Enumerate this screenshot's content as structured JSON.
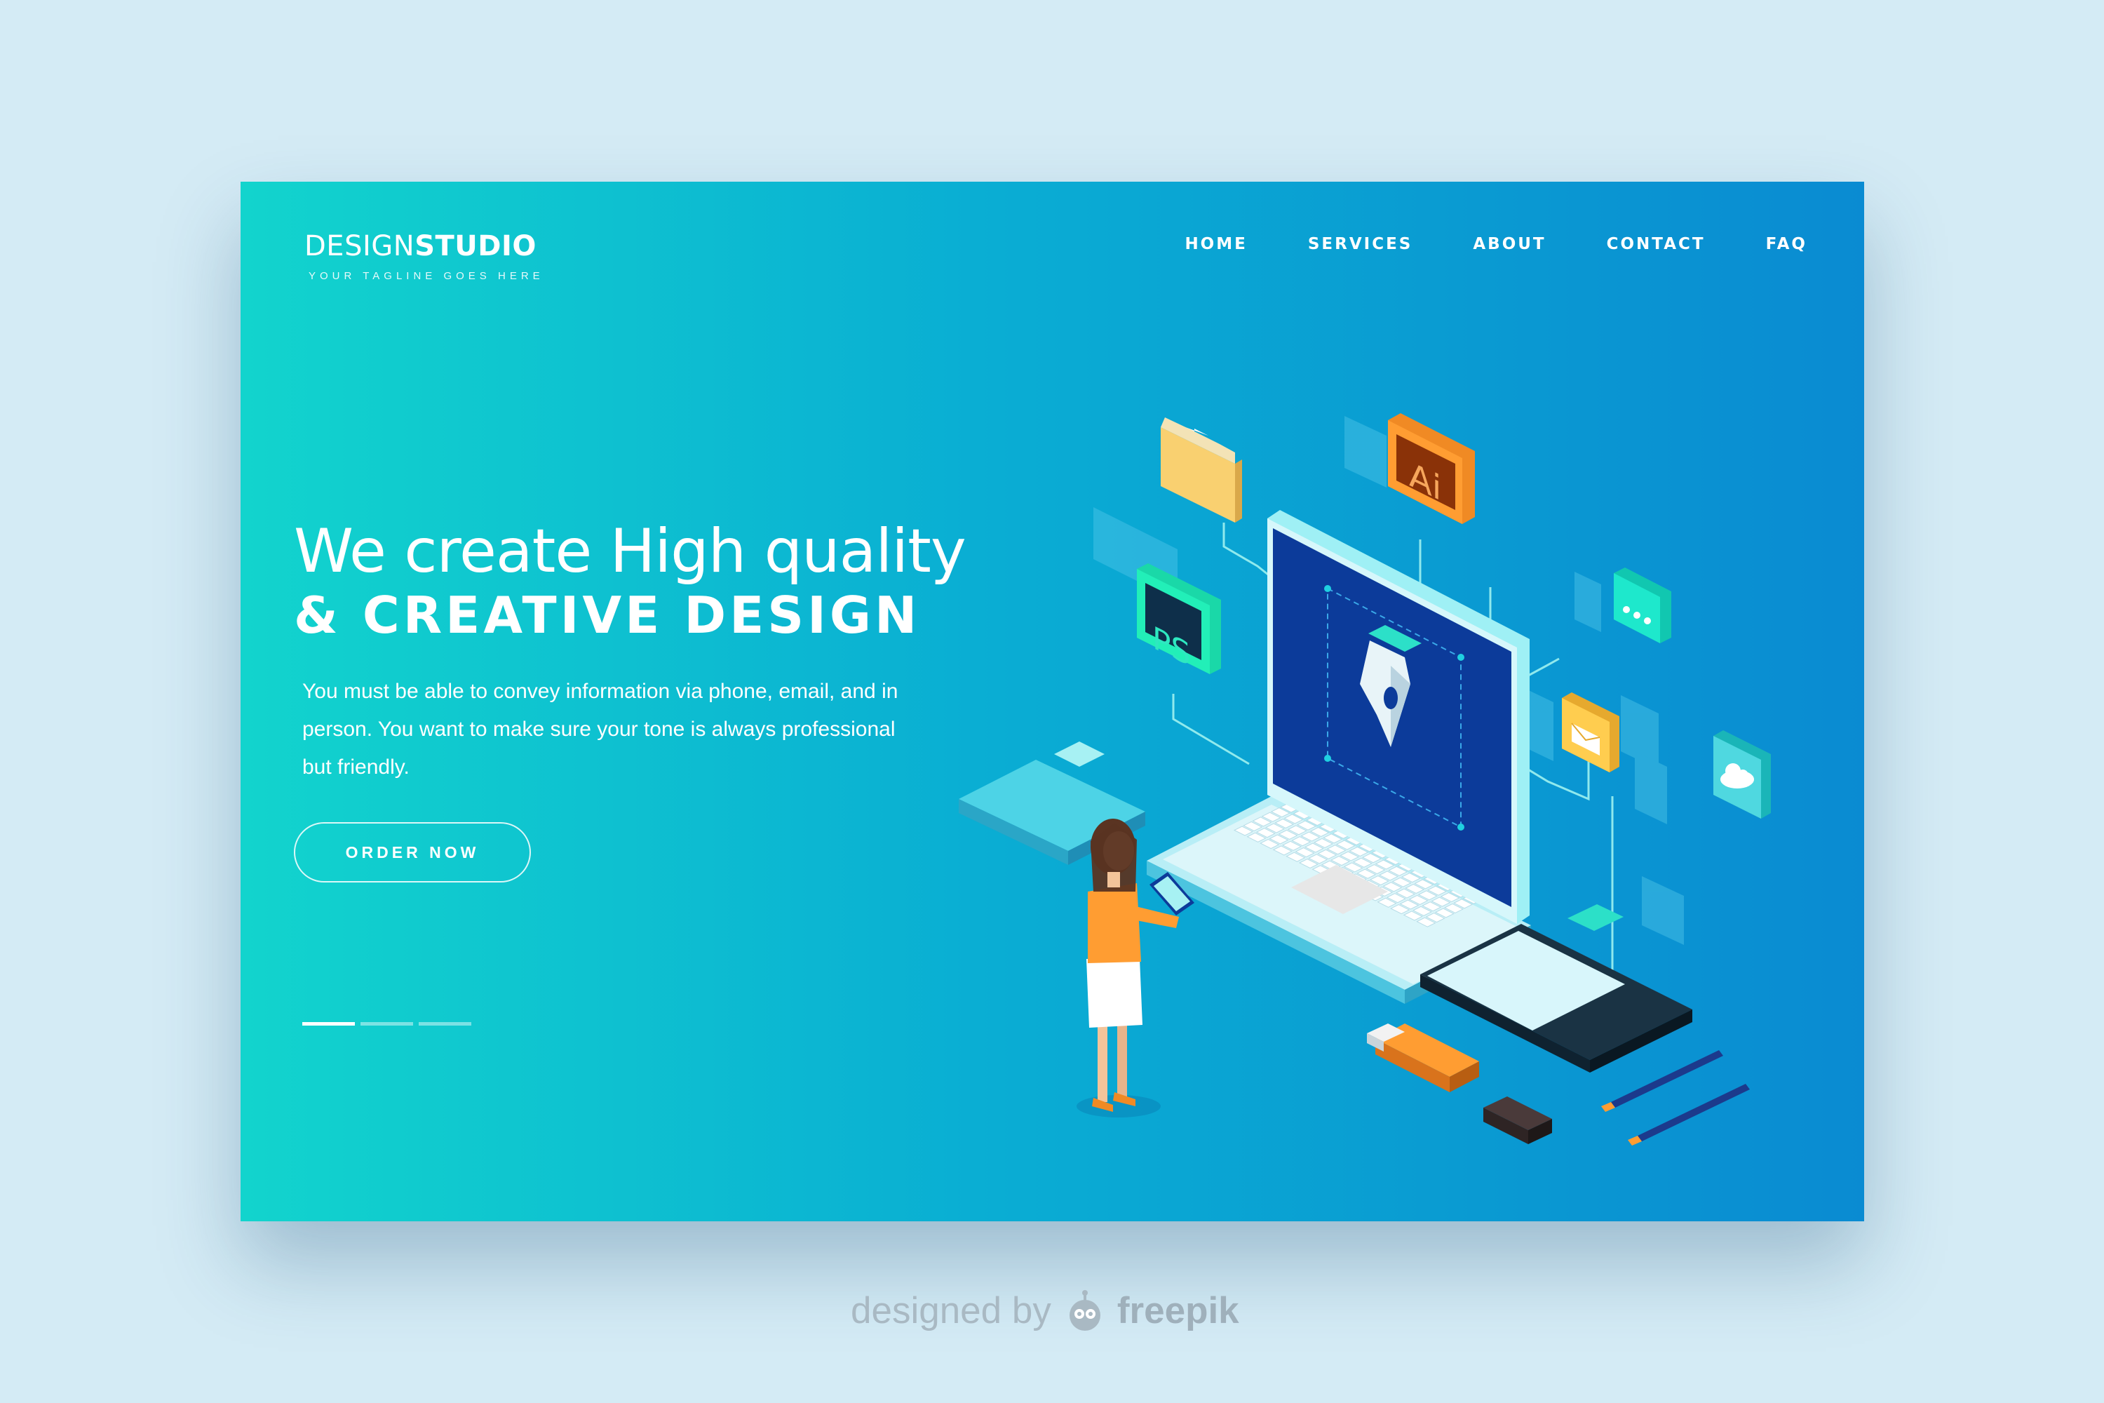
{
  "brand": {
    "name_light": "DESIGN",
    "name_bold": "STUDIO",
    "tagline": "YOUR TAGLINE GOES HERE"
  },
  "nav": {
    "items": [
      "HOME",
      "SERVICES",
      "ABOUT",
      "CONTACT",
      "FAQ"
    ]
  },
  "hero": {
    "line1": "We create High quality",
    "line2": "& CREATIVE DESIGN",
    "description": "You must be able to convey information via phone, email, and in person. You want to make sure your tone is always professional but friendly.",
    "cta": "ORDER NOW"
  },
  "slider": {
    "count": 3,
    "active_index": 0
  },
  "illustration": {
    "icons": [
      "folder-icon",
      "illustrator-icon",
      "photoshop-icon",
      "chat-icon",
      "mail-icon",
      "cloud-icon"
    ],
    "ps_label": "PS",
    "ai_label": "Ai"
  },
  "credit": {
    "prefix": "designed by",
    "brand": "freepik"
  },
  "colors": {
    "background": "#d4ebf5",
    "gradient_start": "#12d4cd",
    "gradient_end": "#0a8bd2",
    "accent_orange": "#f08a24"
  }
}
